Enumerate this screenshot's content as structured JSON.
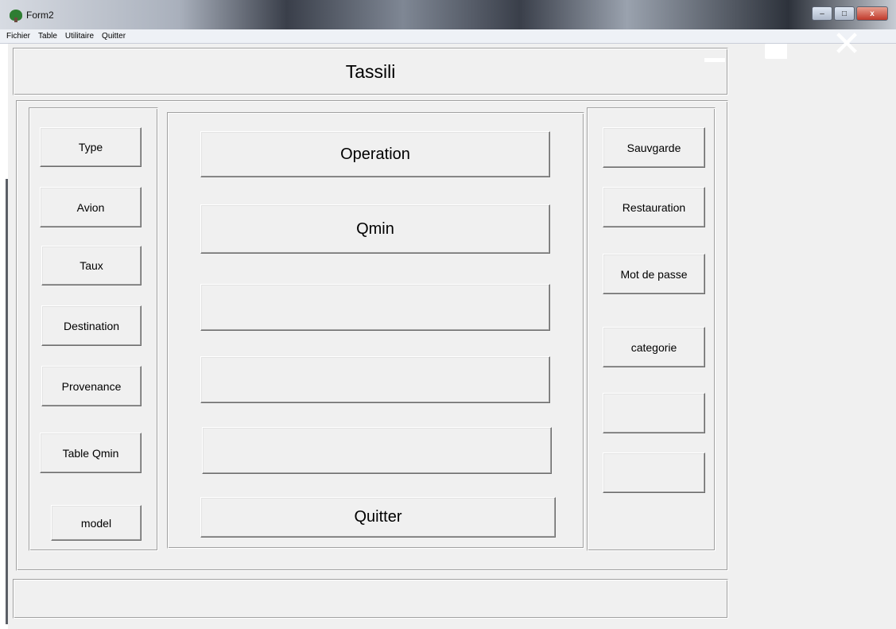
{
  "window": {
    "title": "Form2",
    "controls": {
      "minimize": "–",
      "maximize": "□",
      "close": "x"
    }
  },
  "menu": [
    "Fichier",
    "Table",
    "Utilitaire",
    "Quitter"
  ],
  "header": {
    "title": "Tassili"
  },
  "left_buttons": [
    "Type",
    "Avion",
    "Taux",
    "Destination",
    "Provenance",
    "Table Qmin",
    "model"
  ],
  "center_buttons": [
    "Operation",
    "Qmin",
    "",
    "",
    "",
    "Quitter"
  ],
  "right_buttons": [
    "Sauvgarde",
    "Restauration",
    "Mot de passe",
    "categorie",
    "",
    ""
  ],
  "colors": {
    "face": "#f0f0f0",
    "shadow": "#a0a0a0",
    "highlight": "#ffffff"
  },
  "icons": {
    "app": "tree-app-icon"
  }
}
